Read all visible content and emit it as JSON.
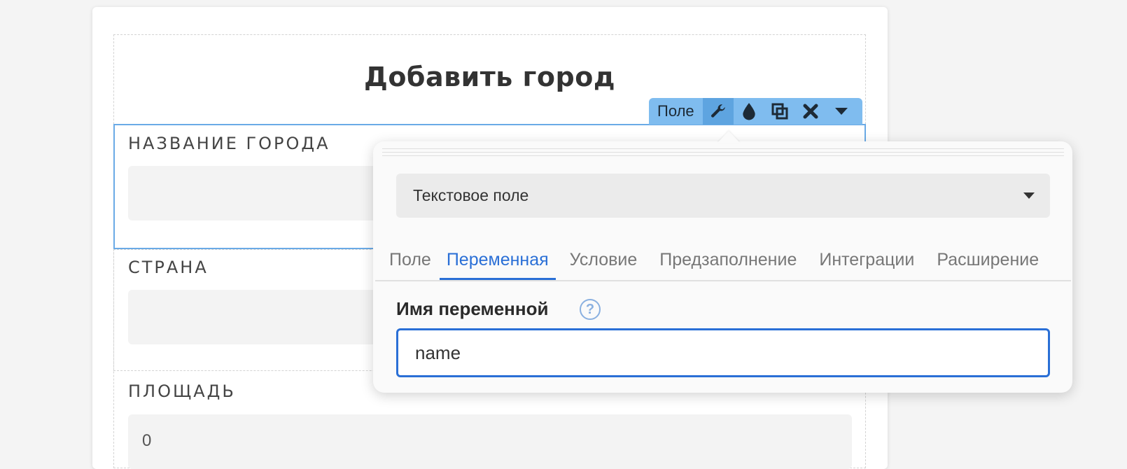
{
  "form": {
    "title": "Добавить город",
    "fields": [
      {
        "label": "НАЗВАНИЕ ГОРОДА",
        "value": ""
      },
      {
        "label": "СТРАНА",
        "value": ""
      },
      {
        "label": "ПЛОЩАДЬ",
        "value": "0"
      }
    ]
  },
  "toolbar": {
    "label": "Поле",
    "icons": [
      "wrench-icon",
      "drop-icon",
      "copy-icon",
      "close-icon",
      "chevron-down-icon"
    ]
  },
  "popover": {
    "field_type": "Текстовое поле",
    "tabs": [
      "Поле",
      "Переменная",
      "Условие",
      "Предзаполнение",
      "Интеграции",
      "Расширение"
    ],
    "active_tab": "Переменная",
    "variable_label": "Имя переменной",
    "variable_value": "name",
    "help": "?"
  },
  "colors": {
    "accent": "#2a6fd6",
    "toolbar": "#7fbcef",
    "selected_border": "#6aaae6"
  }
}
